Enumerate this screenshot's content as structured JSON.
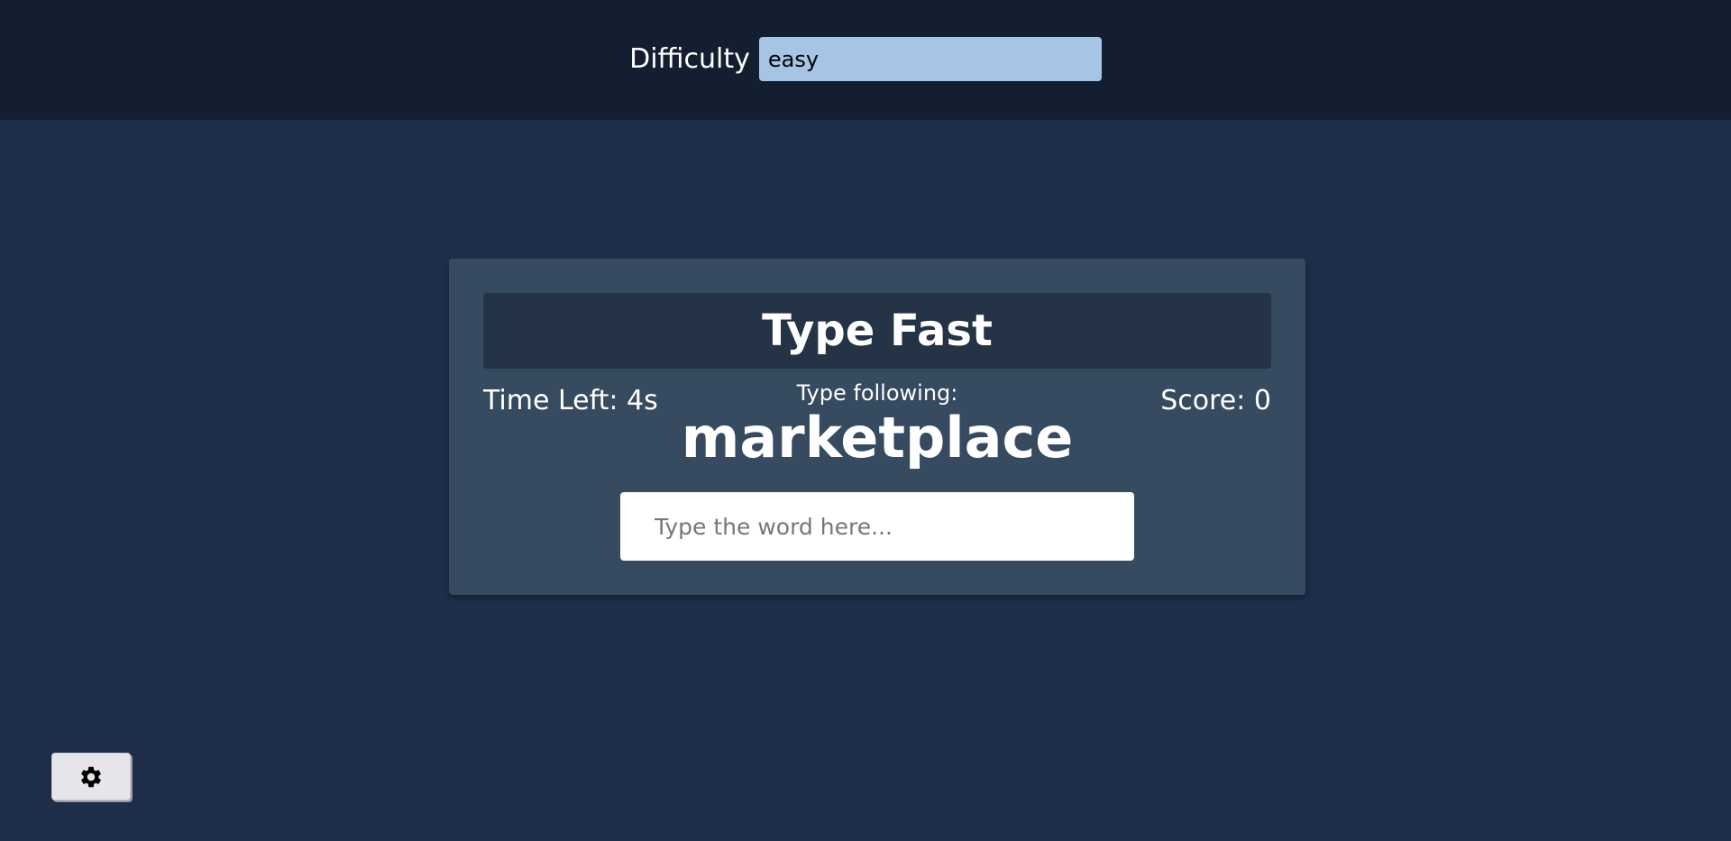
{
  "settings": {
    "difficulty_label": "Difficulty",
    "difficulty_value": "easy",
    "difficulty_options": [
      "easy"
    ]
  },
  "game": {
    "title": "Type Fast",
    "time_left": "Time Left: 4s",
    "score": "Score: 0",
    "prompt_label": "Type following:",
    "word": "marketplace",
    "input_placeholder": "Type the word here...",
    "input_value": ""
  },
  "toolbar": {
    "settings_icon": "gear-icon"
  },
  "colors": {
    "page_background": "#1e2d4a",
    "header_background": "#141e31",
    "card_background": "#364a60",
    "title_background": "#243345",
    "select_background": "#a6c4e3",
    "text": "#ffffff"
  }
}
